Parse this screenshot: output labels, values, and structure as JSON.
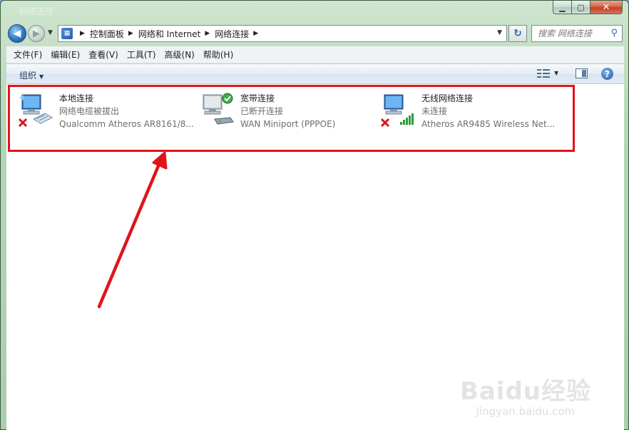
{
  "window": {
    "title": "网络连接",
    "caption": {
      "minimize": "▁",
      "maximize": "▢",
      "close": "✕"
    }
  },
  "address": {
    "crumbs": [
      "控制面板",
      "网络和 Internet",
      "网络连接"
    ],
    "refresh_glyph": "↻"
  },
  "search": {
    "placeholder": "搜索 网络连接"
  },
  "menu": [
    "文件(F)",
    "编辑(E)",
    "查看(V)",
    "工具(T)",
    "高级(N)",
    "帮助(H)"
  ],
  "toolbar": {
    "organize": "组织",
    "help_glyph": "?"
  },
  "connections": [
    {
      "name": "本地连接",
      "status": "网络电缆被拔出",
      "device": "Qualcomm Atheros AR8161/8...",
      "state": "disconnected",
      "adapter": "ethernet-adapter-icon"
    },
    {
      "name": "宽带连接",
      "status": "已断开连接",
      "device": "WAN Miniport (PPPOE)",
      "state": "ok",
      "adapter": "modem-icon"
    },
    {
      "name": "无线网络连接",
      "status": "未连接",
      "device": "Atheros AR9485 Wireless Net...",
      "state": "disconnected",
      "adapter": "wifi-signal-icon"
    }
  ],
  "colors": {
    "highlight": "#e0141b",
    "status_text": "#6d6d6d",
    "link_blue": "#1e3a5f"
  },
  "watermark": {
    "brand": "Baidu经验",
    "url": "jingyan.baidu.com"
  }
}
